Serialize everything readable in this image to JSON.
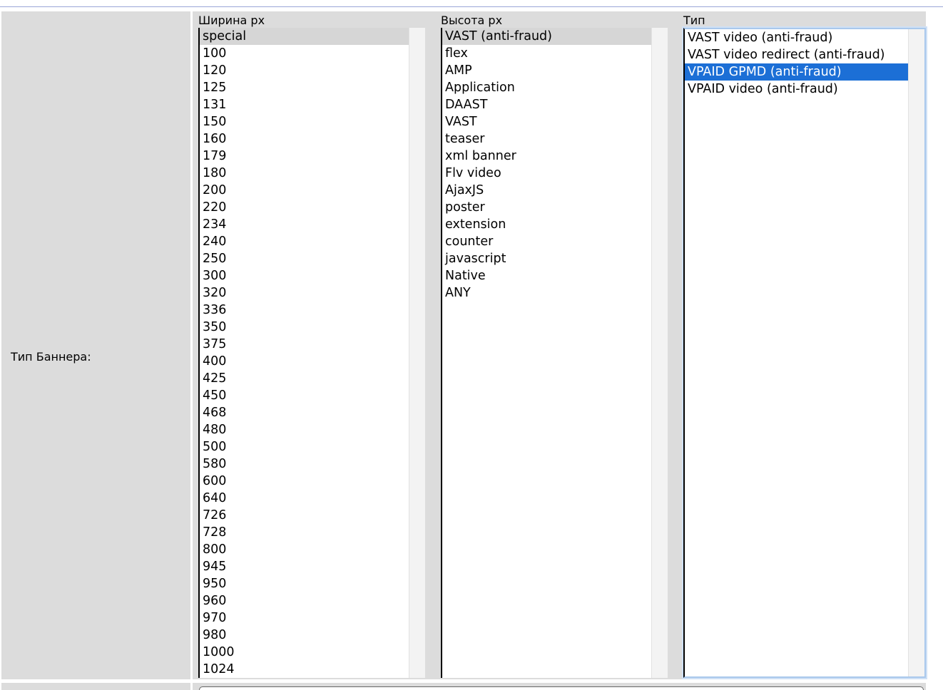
{
  "form": {
    "row_label": "Тип Баннера:",
    "width": {
      "header": "Ширина px",
      "selected_index": 0,
      "options": [
        "special",
        "100",
        "120",
        "125",
        "131",
        "150",
        "160",
        "179",
        "180",
        "200",
        "220",
        "234",
        "240",
        "250",
        "300",
        "320",
        "336",
        "350",
        "375",
        "400",
        "425",
        "450",
        "468",
        "480",
        "500",
        "580",
        "600",
        "640",
        "726",
        "728",
        "800",
        "945",
        "950",
        "960",
        "970",
        "980",
        "1000",
        "1024"
      ]
    },
    "height": {
      "header": "Высота px",
      "selected_index": 0,
      "options": [
        "VAST (anti-fraud)",
        "flex",
        "AMP",
        "Application",
        "DAAST",
        "VAST",
        "teaser",
        "xml banner",
        "Flv video",
        "AjaxJS",
        "poster",
        "extension",
        "counter",
        "javascript",
        "Native",
        "ANY"
      ]
    },
    "type": {
      "header": "Тип",
      "selected_index": 2,
      "options": [
        "VAST video (anti-fraud)",
        "VAST video redirect (anti-fraud)",
        "VPAID GPMD (anti-fraud)",
        "VPAID video (anti-fraud)"
      ]
    }
  },
  "colors": {
    "cell_background": "#dcdcdc",
    "selection_active": "#1c6fd6",
    "selection_inactive": "#d6d6d6",
    "focus_ring": "#a9c8ec"
  }
}
